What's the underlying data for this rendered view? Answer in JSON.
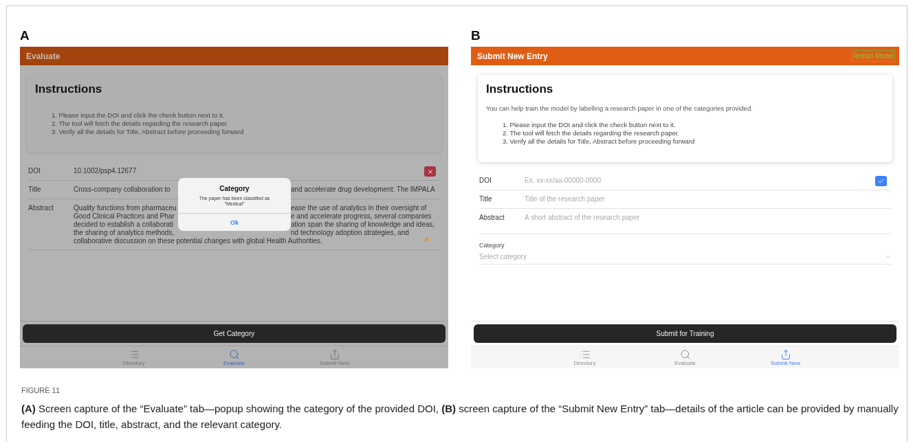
{
  "panels": [
    {
      "kind": "evaluate",
      "label": "A",
      "dimmed": true,
      "title": "Evaluate",
      "instructions": {
        "heading": "Instructions",
        "steps": [
          "1. Please input the DOI and click the check button next to it.",
          "2. The tool will fetch the details regarding the research paper.",
          "3. Verify all the details for Title, Abstract before proceeding forward"
        ]
      },
      "fields": [
        {
          "label": "DOI",
          "lines": [
            {
              "left": "10.1002/psp4.12677"
            }
          ]
        },
        {
          "label": "Title",
          "lines": [
            {
              "left": "Cross-company collaboration to",
              "right": "and accelerate drug development: The IMPALA"
            }
          ]
        },
        {
          "label": "Abstract",
          "marker": true,
          "lines": [
            {
              "left": "Quality functions from pharmaceu",
              "right": "ease the use of analytics in their oversight of"
            },
            {
              "left": "Good Clinical Practices and Phar",
              "right": "e and accelerate progress, several companies"
            },
            {
              "left": "decided to establish a collaborati",
              "right": "ation span the sharing of knowledge and ideas,"
            },
            {
              "left": "the sharing of analytics methods,",
              "right": "nd technology adoption strategies, and"
            },
            {
              "full": "collaborative discussion on these potential changes with global Health Authorities."
            }
          ]
        }
      ],
      "popup": {
        "title": "Category",
        "message": "The paper has been classified as \"Medical\"",
        "button": "Ok"
      },
      "primary_button": "Get Category",
      "tabs": [
        {
          "label": "Directory",
          "selected": false
        },
        {
          "label": "Evaluate",
          "selected": true
        },
        {
          "label": "Submit New",
          "selected": false
        }
      ]
    },
    {
      "kind": "submit",
      "label": "B",
      "dimmed": false,
      "title": "Submit New Entry",
      "header_button": "Retrain Model",
      "instructions": {
        "heading": "Instructions",
        "intro": "You can help train the model by labelling a research paper in one of the categories provided.",
        "steps": [
          "1. Please input the DOI and click the check button next to it.",
          "2. The tool will fetch the details regarding the research paper.",
          "3. Verify all the details for Title, Abstract before proceeding forward"
        ]
      },
      "fields": [
        {
          "label": "DOI",
          "placeholder": "Ex. xx-xx/aa-00000-0000"
        },
        {
          "label": "Title",
          "placeholder": "Title of the research paper"
        },
        {
          "label": "Abstract",
          "placeholder": "A short abstract of the research paper"
        }
      ],
      "category": {
        "label": "Category",
        "placeholder": "Select category"
      },
      "primary_button": "Submit for Training",
      "tabs": [
        {
          "label": "Directory",
          "selected": false
        },
        {
          "label": "Evaluate",
          "selected": false
        },
        {
          "label": "Submit New",
          "selected": true
        }
      ]
    }
  ],
  "caption": {
    "number": "FIGURE 11",
    "text": "**(A)** Screen capture of the “Evaluate” tab—popup showing the category of the provided DOI, **(B)** screen capture of the “Submit New Entry” tab—details of the article can be provided by manually feeding the DOI, title, abstract, and the relevant category."
  }
}
